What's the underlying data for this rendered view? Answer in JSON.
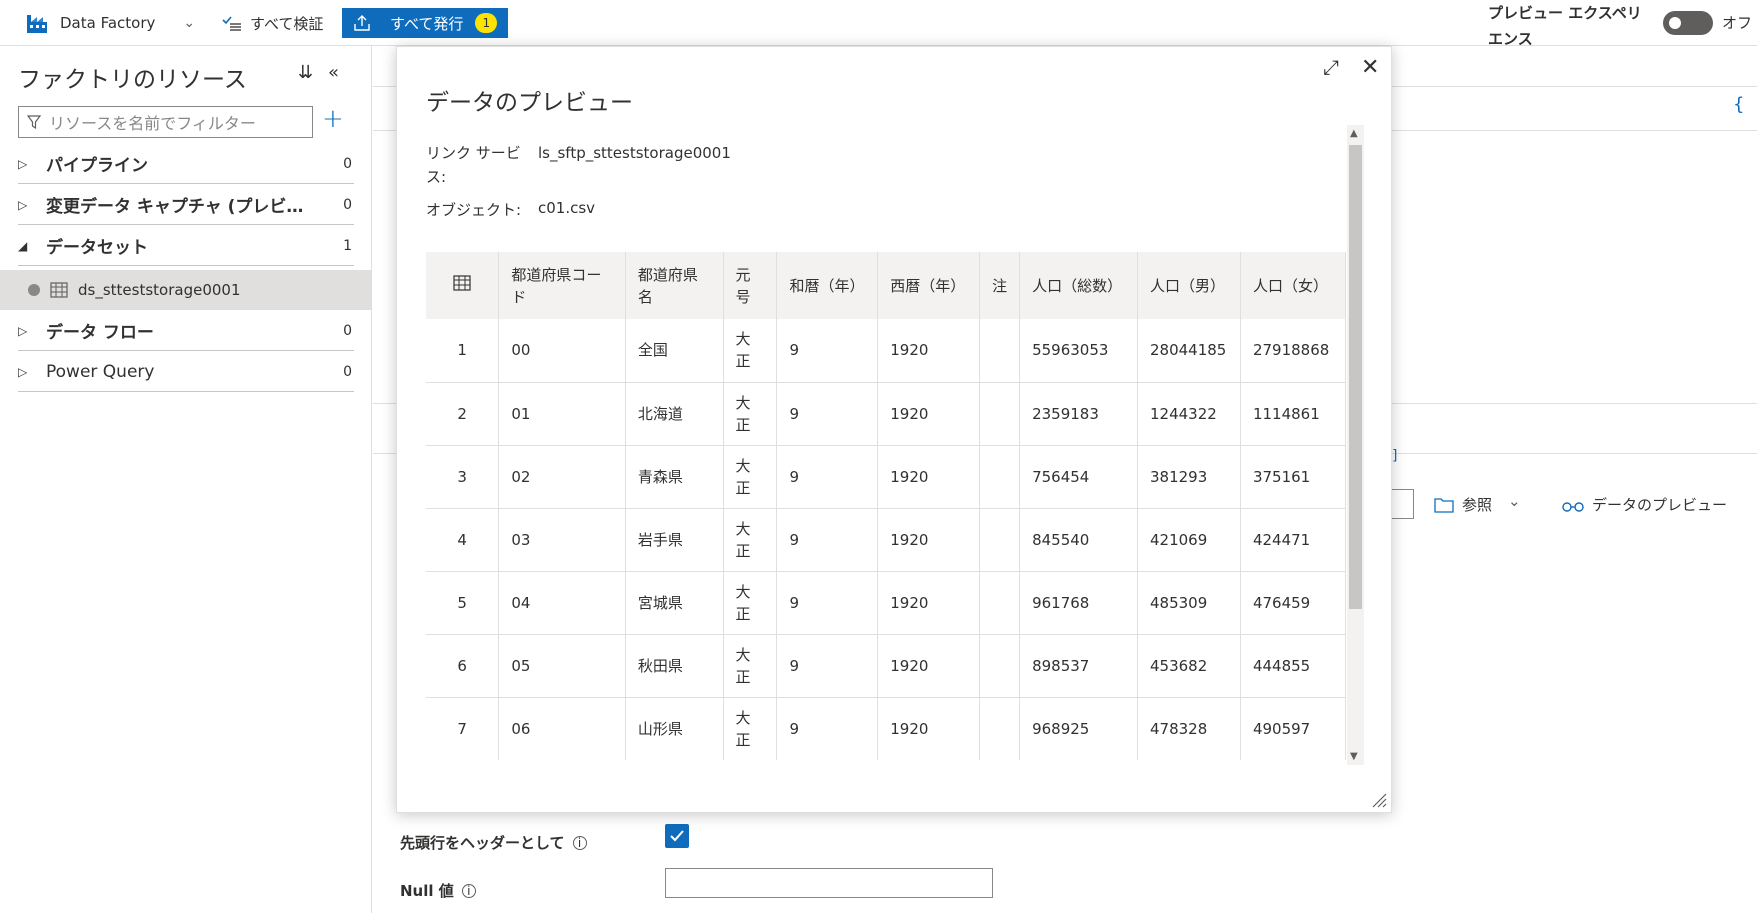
{
  "topbar": {
    "brand": "Data Factory",
    "validate_all": "すべて検証",
    "publish_all": "すべて発行",
    "publish_badge": "1",
    "preview_experience": "プレビュー エクスペリエンス",
    "toggle_label": "オフ"
  },
  "sidebar": {
    "title": "ファクトリのリソース",
    "filter_placeholder": "リソースを名前でフィルター",
    "items": [
      {
        "label": "パイプライン",
        "count": "0"
      },
      {
        "label": "変更データ キャプチャ (プレビ…",
        "count": "0"
      },
      {
        "label": "データセット",
        "count": "1"
      },
      {
        "label": "データ フロー",
        "count": "0"
      },
      {
        "label": "Power Query",
        "count": "0"
      }
    ],
    "dataset_item": "ds_stteststorage0001"
  },
  "background": {
    "browse": "参照",
    "preview_data": "データのプレビュー",
    "first_row_header": "先頭行をヘッダーとして",
    "null_value": "Null 値",
    "brace": "{",
    "bracket": "]"
  },
  "dialog": {
    "title": "データのプレビュー",
    "linked_service_label": "リンク サービス:",
    "linked_service_value": "ls_sftp_stteststorage0001",
    "object_label": "オブジェクト:",
    "object_value": "c01.csv",
    "columns": [
      "都道府県コード",
      "都道府県名",
      "元号",
      "和暦（年）",
      "西暦（年）",
      "注",
      "人口（総数）",
      "人口（男）",
      "人口（女）"
    ],
    "rows": [
      [
        "1",
        "00",
        "全国",
        "大正",
        "9",
        "1920",
        "",
        "55963053",
        "28044185",
        "27918868"
      ],
      [
        "2",
        "01",
        "北海道",
        "大正",
        "9",
        "1920",
        "",
        "2359183",
        "1244322",
        "1114861"
      ],
      [
        "3",
        "02",
        "青森県",
        "大正",
        "9",
        "1920",
        "",
        "756454",
        "381293",
        "375161"
      ],
      [
        "4",
        "03",
        "岩手県",
        "大正",
        "9",
        "1920",
        "",
        "845540",
        "421069",
        "424471"
      ],
      [
        "5",
        "04",
        "宮城県",
        "大正",
        "9",
        "1920",
        "",
        "961768",
        "485309",
        "476459"
      ],
      [
        "6",
        "05",
        "秋田県",
        "大正",
        "9",
        "1920",
        "",
        "898537",
        "453682",
        "444855"
      ],
      [
        "7",
        "06",
        "山形県",
        "大正",
        "9",
        "1920",
        "",
        "968925",
        "478328",
        "490597"
      ]
    ]
  }
}
